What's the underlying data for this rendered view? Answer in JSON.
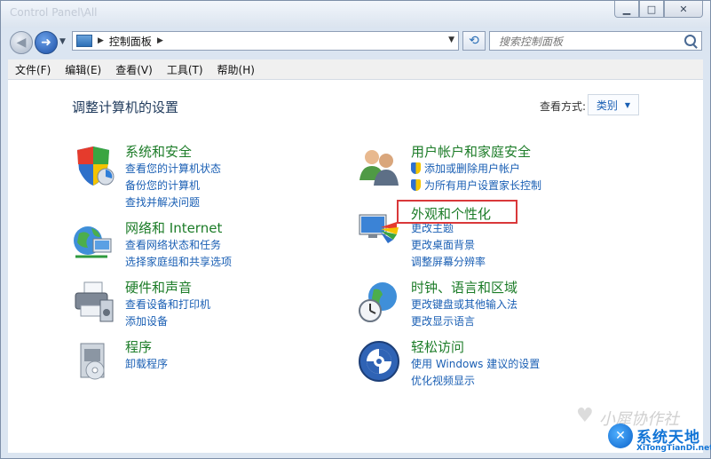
{
  "window": {
    "title": "Control Panel\\All"
  },
  "nav": {
    "breadcrumb": "控制面板",
    "search_placeholder": "搜索控制面板"
  },
  "menu": [
    "文件(F)",
    "编辑(E)",
    "查看(V)",
    "工具(T)",
    "帮助(H)"
  ],
  "content": {
    "heading": "调整计算机的设置",
    "view_by_label": "查看方式:",
    "view_by_value": "类别"
  },
  "categories": [
    {
      "title": "系统和安全",
      "links": [
        "查看您的计算机状态",
        "备份您的计算机",
        "查找并解决问题"
      ],
      "icon": "system-security-icon"
    },
    {
      "title": "网络和 Internet",
      "links": [
        "查看网络状态和任务",
        "选择家庭组和共享选项"
      ],
      "icon": "network-globe-icon"
    },
    {
      "title": "硬件和声音",
      "links": [
        "查看设备和打印机",
        "添加设备"
      ],
      "icon": "printer-icon"
    },
    {
      "title": "程序",
      "links": [
        "卸载程序"
      ],
      "icon": "programs-box-icon"
    },
    {
      "title": "用户帐户和家庭安全",
      "links": [
        "添加或删除用户帐户",
        "为所有用户设置家长控制"
      ],
      "icon": "users-icon"
    },
    {
      "title": "外观和个性化",
      "links": [
        "更改主题",
        "更改桌面背景",
        "调整屏幕分辨率"
      ],
      "icon": "monitor-palette-icon"
    },
    {
      "title": "时钟、语言和区域",
      "links": [
        "更改键盘或其他输入法",
        "更改显示语言"
      ],
      "icon": "globe-clock-icon"
    },
    {
      "title": "轻松访问",
      "links": [
        "使用 Windows 建议的设置",
        "优化视频显示"
      ],
      "icon": "ease-of-access-icon"
    }
  ],
  "watermark": {
    "text": "小犀协作社",
    "brand": "系统天地",
    "url": "XiTongTianDi.net"
  }
}
